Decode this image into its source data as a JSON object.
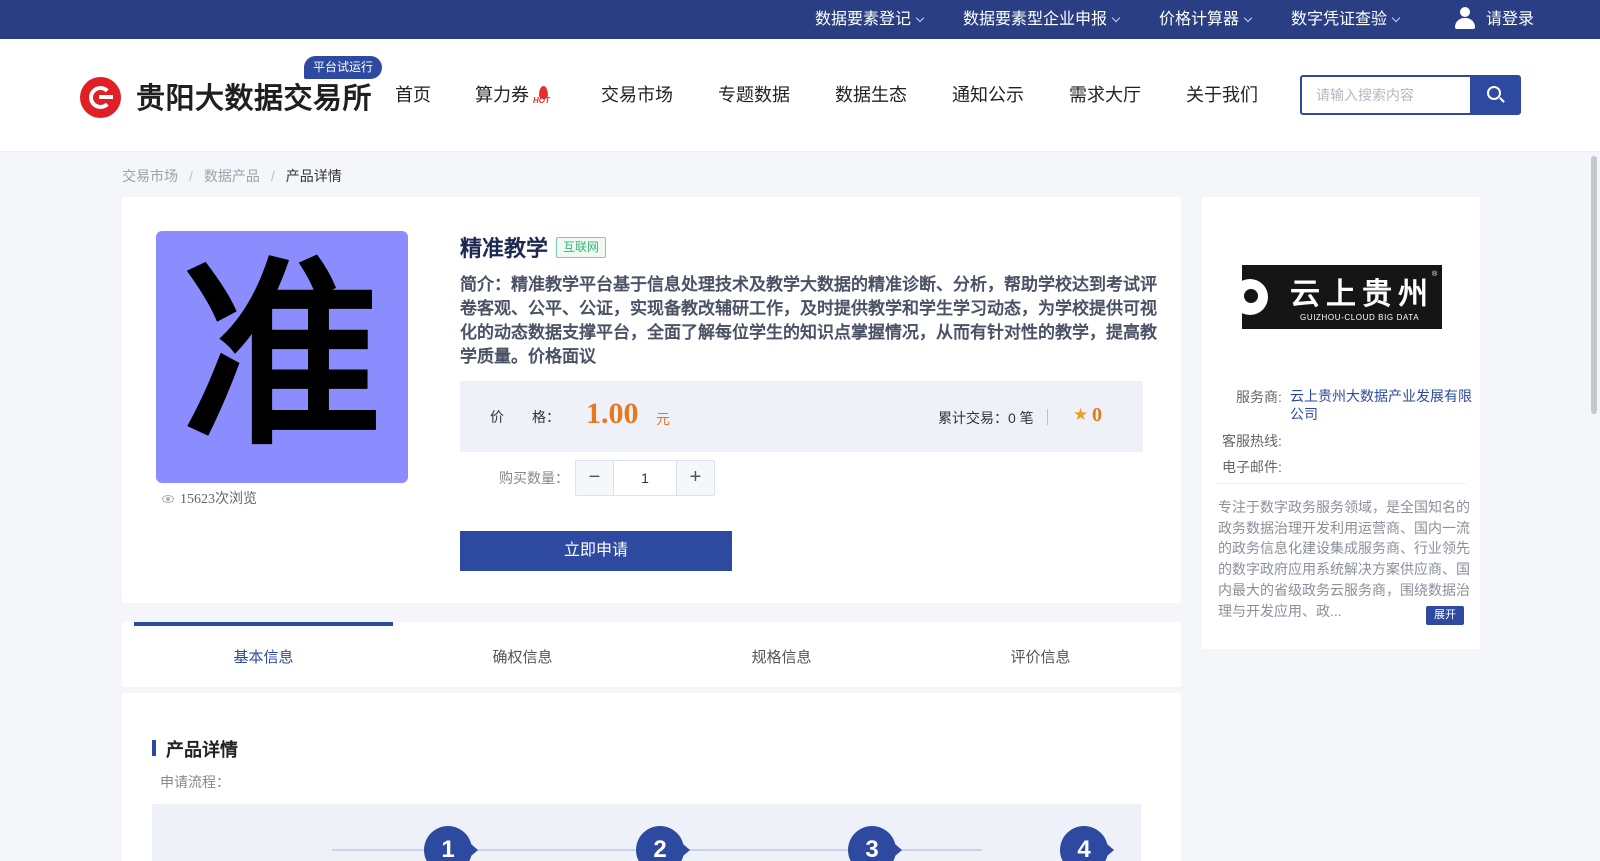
{
  "topbar": {
    "items": [
      {
        "label": "数据要素登记"
      },
      {
        "label": "数据要素型企业申报"
      },
      {
        "label": "价格计算器"
      },
      {
        "label": "数字凭证查验"
      }
    ],
    "login_label": "请登录",
    "bg_color": "#2a3f83"
  },
  "header": {
    "site_name": "贵阳大数据交易所",
    "badge": "平台试运行",
    "nav": [
      {
        "label": "首页"
      },
      {
        "label": "算力券",
        "icon": "hot-icon",
        "icon_text": "HOT"
      },
      {
        "label": "交易市场"
      },
      {
        "label": "专题数据"
      },
      {
        "label": "数据生态"
      },
      {
        "label": "通知公示"
      },
      {
        "label": "需求大厅"
      },
      {
        "label": "关于我们"
      }
    ],
    "search": {
      "placeholder": "请输入搜索内容",
      "value": ""
    },
    "accent_color": "#2d4aa0"
  },
  "breadcrumb": {
    "items": [
      "交易市场",
      "数据产品",
      "产品详情"
    ],
    "separator": "/"
  },
  "product": {
    "image_glyph": "准",
    "image_bg": "#8b8cfd",
    "views": "15623次浏览",
    "title": "精准教学",
    "tag": "互联网",
    "description": "简介：精准教学平台基于信息处理技术及教学大数据的精准诊断、分析，帮助学校达到考试评卷客观、公平、公证，实现备教改辅研工作，及时提供教学和学生学习动态，为学校提供可视化的动态数据支撑平台，全面了解每位学生的知识点掌握情况，从而有针对性的教学，提高教学质量。价格面议",
    "price_label": "价　　格：",
    "price": "1.00",
    "price_unit": "元",
    "trades": "累计交易：0 笔",
    "rating": "0",
    "quantity_label": "购买数量：",
    "quantity": "1",
    "apply_label": "立即申请",
    "price_color": "#e8781e"
  },
  "tabs": [
    {
      "label": "基本信息",
      "active": true
    },
    {
      "label": "确权信息"
    },
    {
      "label": "规格信息"
    },
    {
      "label": "评价信息"
    }
  ],
  "detail": {
    "section_title": "产品详情",
    "flow_label": "申请流程：",
    "steps": [
      "1",
      "2",
      "3",
      "4"
    ]
  },
  "vendor": {
    "logo_cn": "云上贵州",
    "logo_en": "GUIZHOU-CLOUD BIG DATA",
    "logo_reg": "®",
    "provider_label": "服务商:",
    "provider_name": "云上贵州大数据产业发展有限公司",
    "hotline_label": "客服热线:",
    "hotline": "",
    "email_label": "电子邮件:",
    "email": "",
    "intro": "专注于数字政务服务领域，是全国知名的政务数据治理开发利用运营商、国内一流的政务信息化建设集成服务商、行业领先的数字政府应用系统解决方案供应商、国内最大的省级政务云服务商，围绕数据治理与开发应用、政...",
    "expand_label": "展开"
  }
}
